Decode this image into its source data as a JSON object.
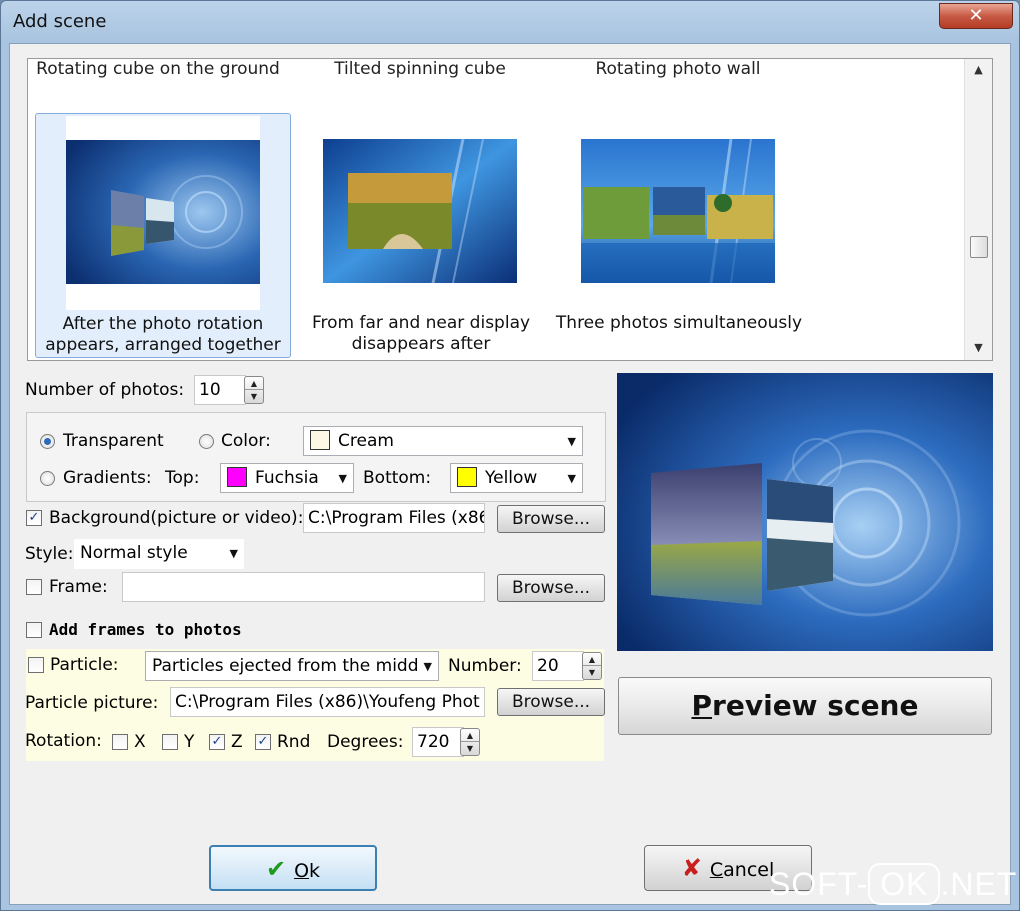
{
  "window": {
    "title": "Add scene",
    "close_glyph": "✕"
  },
  "gallery": {
    "top_captions": [
      "Rotating cube on the ground",
      "Tilted spinning cube",
      "Rotating photo wall"
    ],
    "tiles": [
      {
        "line1": "After the photo rotation",
        "line2": "appears, arranged together",
        "selected": true
      },
      {
        "line1": "From far and near display",
        "line2": "disappears after",
        "selected": false
      },
      {
        "line1": "Three photos simultaneously",
        "line2": "",
        "selected": false
      }
    ]
  },
  "settings": {
    "num_photos_label": "Number of photos:",
    "num_photos_value": "10",
    "transparent_label": "Transparent",
    "color_label": "Color:",
    "color_value": "Cream",
    "gradients_label": "Gradients:",
    "top_label": "Top:",
    "top_value": "Fuchsia",
    "bottom_label": "Bottom:",
    "bottom_value": "Yellow",
    "background_label": "Background(picture or video):",
    "background_path": "C:\\Program Files (x86",
    "browse_label": "Browse...",
    "style_label": "Style:",
    "style_value": "Normal style",
    "frame_label": "Frame:",
    "frame_path": "",
    "add_frames_label": "Add frames to photos",
    "particle_label": "Particle:",
    "particle_value": "Particles ejected from the midd",
    "number_label": "Number:",
    "number_value": "20",
    "particle_picture_label": "Particle picture:",
    "particle_picture_path": "C:\\Program Files (x86)\\Youfeng Phot",
    "rotation_label": "Rotation:",
    "rot_x": "X",
    "rot_y": "Y",
    "rot_z": "Z",
    "rot_rnd": "Rnd",
    "degrees_label": "Degrees:",
    "degrees_value": "720"
  },
  "checks": {
    "background": true,
    "frame": false,
    "add_frames": false,
    "particle": false,
    "rot_x": false,
    "rot_y": false,
    "rot_z": true,
    "rot_rnd": true
  },
  "radios": {
    "selected": "transparent"
  },
  "colors": {
    "cream": "#fdf7e6",
    "fuchsia": "#ff00ff",
    "yellow": "#ffff00",
    "accent": "#2d6bb8"
  },
  "preview": {
    "button_label_underlined": "P",
    "button_label_rest": "review scene"
  },
  "footer": {
    "ok_underlined": "O",
    "ok_rest": "k",
    "cancel_underlined": "C",
    "cancel_rest": "ancel",
    "ok_icon": "checkmark-icon",
    "cancel_icon": "x-icon"
  },
  "watermark": {
    "left": "SOFT-",
    "ok": "OK",
    "right": ".NET"
  }
}
